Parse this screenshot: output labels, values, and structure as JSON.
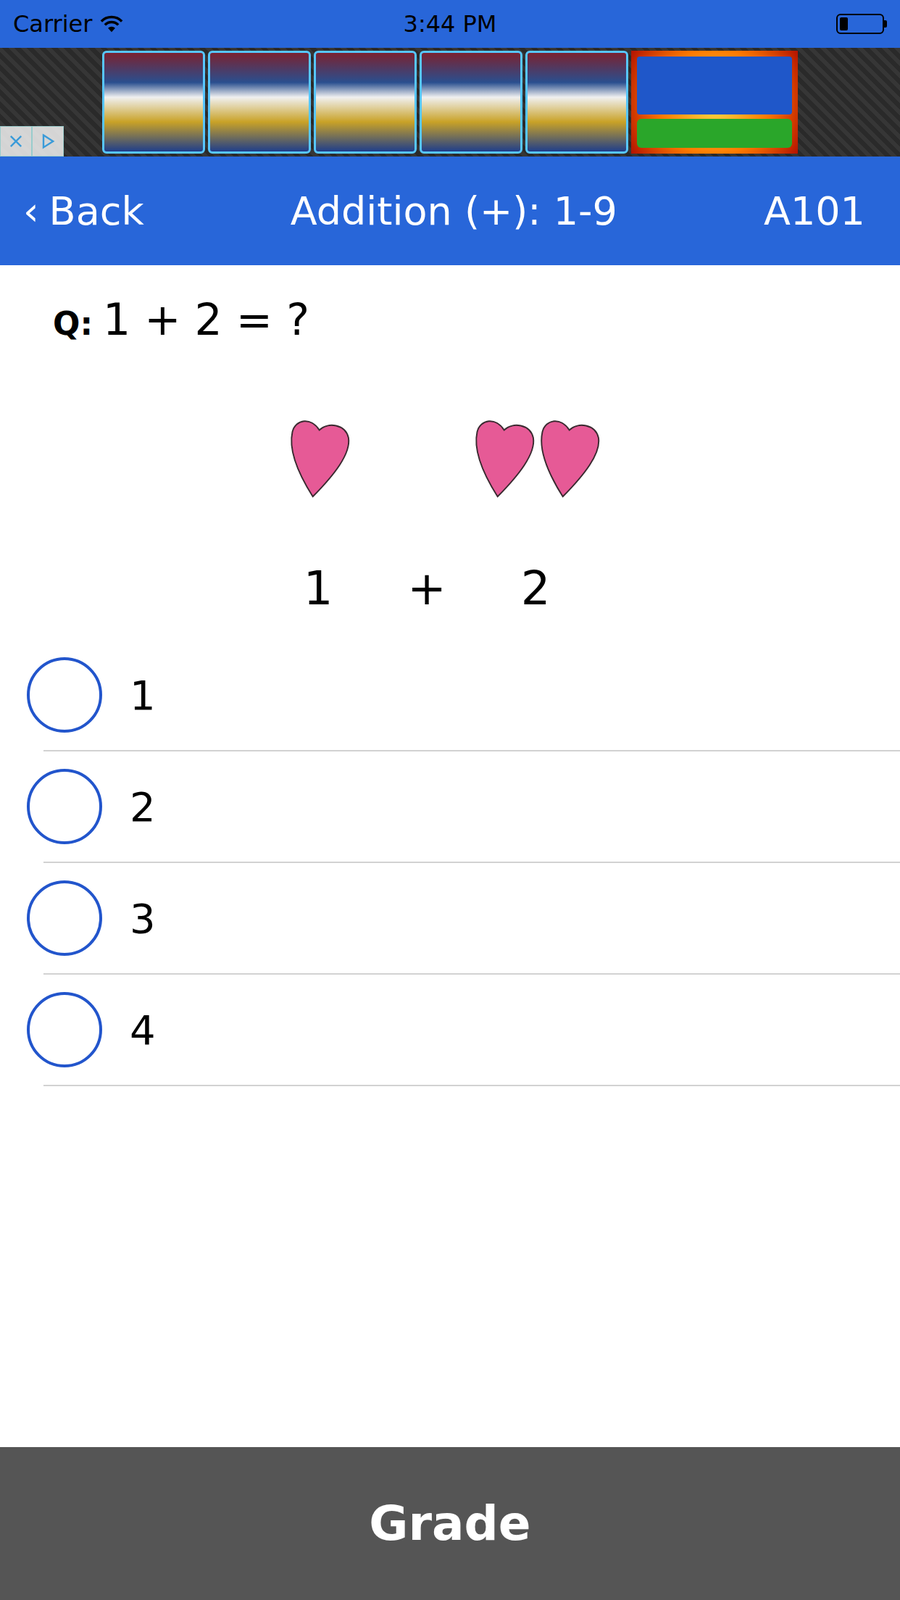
{
  "status_bar": {
    "carrier": "Carrier",
    "time": "3:44 PM",
    "battery_level": 0.2
  },
  "nav": {
    "back_icon": "‹",
    "back": "Back",
    "title": "Addition (+): 1-9",
    "code": "A101"
  },
  "question": {
    "prefix": "Q:",
    "text": "1 + 2 = ?"
  },
  "illustration": {
    "groups": [
      {
        "count": 1,
        "label": "1"
      },
      {
        "count": 2,
        "label": "2"
      }
    ],
    "operator": "+"
  },
  "options": [
    {
      "label": "1",
      "selected": false
    },
    {
      "label": "2",
      "selected": false
    },
    {
      "label": "3",
      "selected": false
    },
    {
      "label": "4",
      "selected": false
    }
  ],
  "grade_button": "Grade"
}
